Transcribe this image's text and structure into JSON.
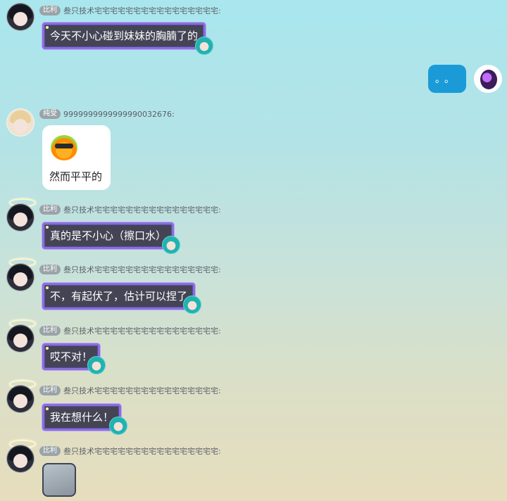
{
  "messages": [
    {
      "sender": {
        "badge": "比利",
        "nick": "叁只技术宅宅宅宅宅宅宅宅宅宅宅宅宅宅宅宅:"
      },
      "text": "今天不小心碰到妹妹的胸腩了的"
    },
    {
      "self": true,
      "text": "。。"
    },
    {
      "sender": {
        "badge": "纯受",
        "nick": "9999999999999990032676:"
      },
      "emoji": "sunglasses-emoji",
      "text": "然而平平的"
    },
    {
      "sender": {
        "badge": "比利",
        "nick": "叁只技术宅宅宅宅宅宅宅宅宅宅宅宅宅宅宅宅:"
      },
      "text": "真的是不小心（擦口水）"
    },
    {
      "sender": {
        "badge": "比利",
        "nick": "叁只技术宅宅宅宅宅宅宅宅宅宅宅宅宅宅宅宅:"
      },
      "text": "不，有起伏了，估计可以捏了"
    },
    {
      "sender": {
        "badge": "比利",
        "nick": "叁只技术宅宅宅宅宅宅宅宅宅宅宅宅宅宅宅宅:"
      },
      "text": "哎不对！"
    },
    {
      "sender": {
        "badge": "比利",
        "nick": "叁只技术宅宅宅宅宅宅宅宅宅宅宅宅宅宅宅宅:"
      },
      "text": "我在想什么！"
    },
    {
      "sender": {
        "badge": "比利",
        "nick": "叁只技术宅宅宅宅宅宅宅宅宅宅宅宅宅宅宅宅:"
      },
      "image": "sent-image-thumbnail"
    }
  ],
  "colors": {
    "bubble_dark": "#444455",
    "bubble_border": "#8a6fd8",
    "self_bubble": "#1a9bd8"
  }
}
